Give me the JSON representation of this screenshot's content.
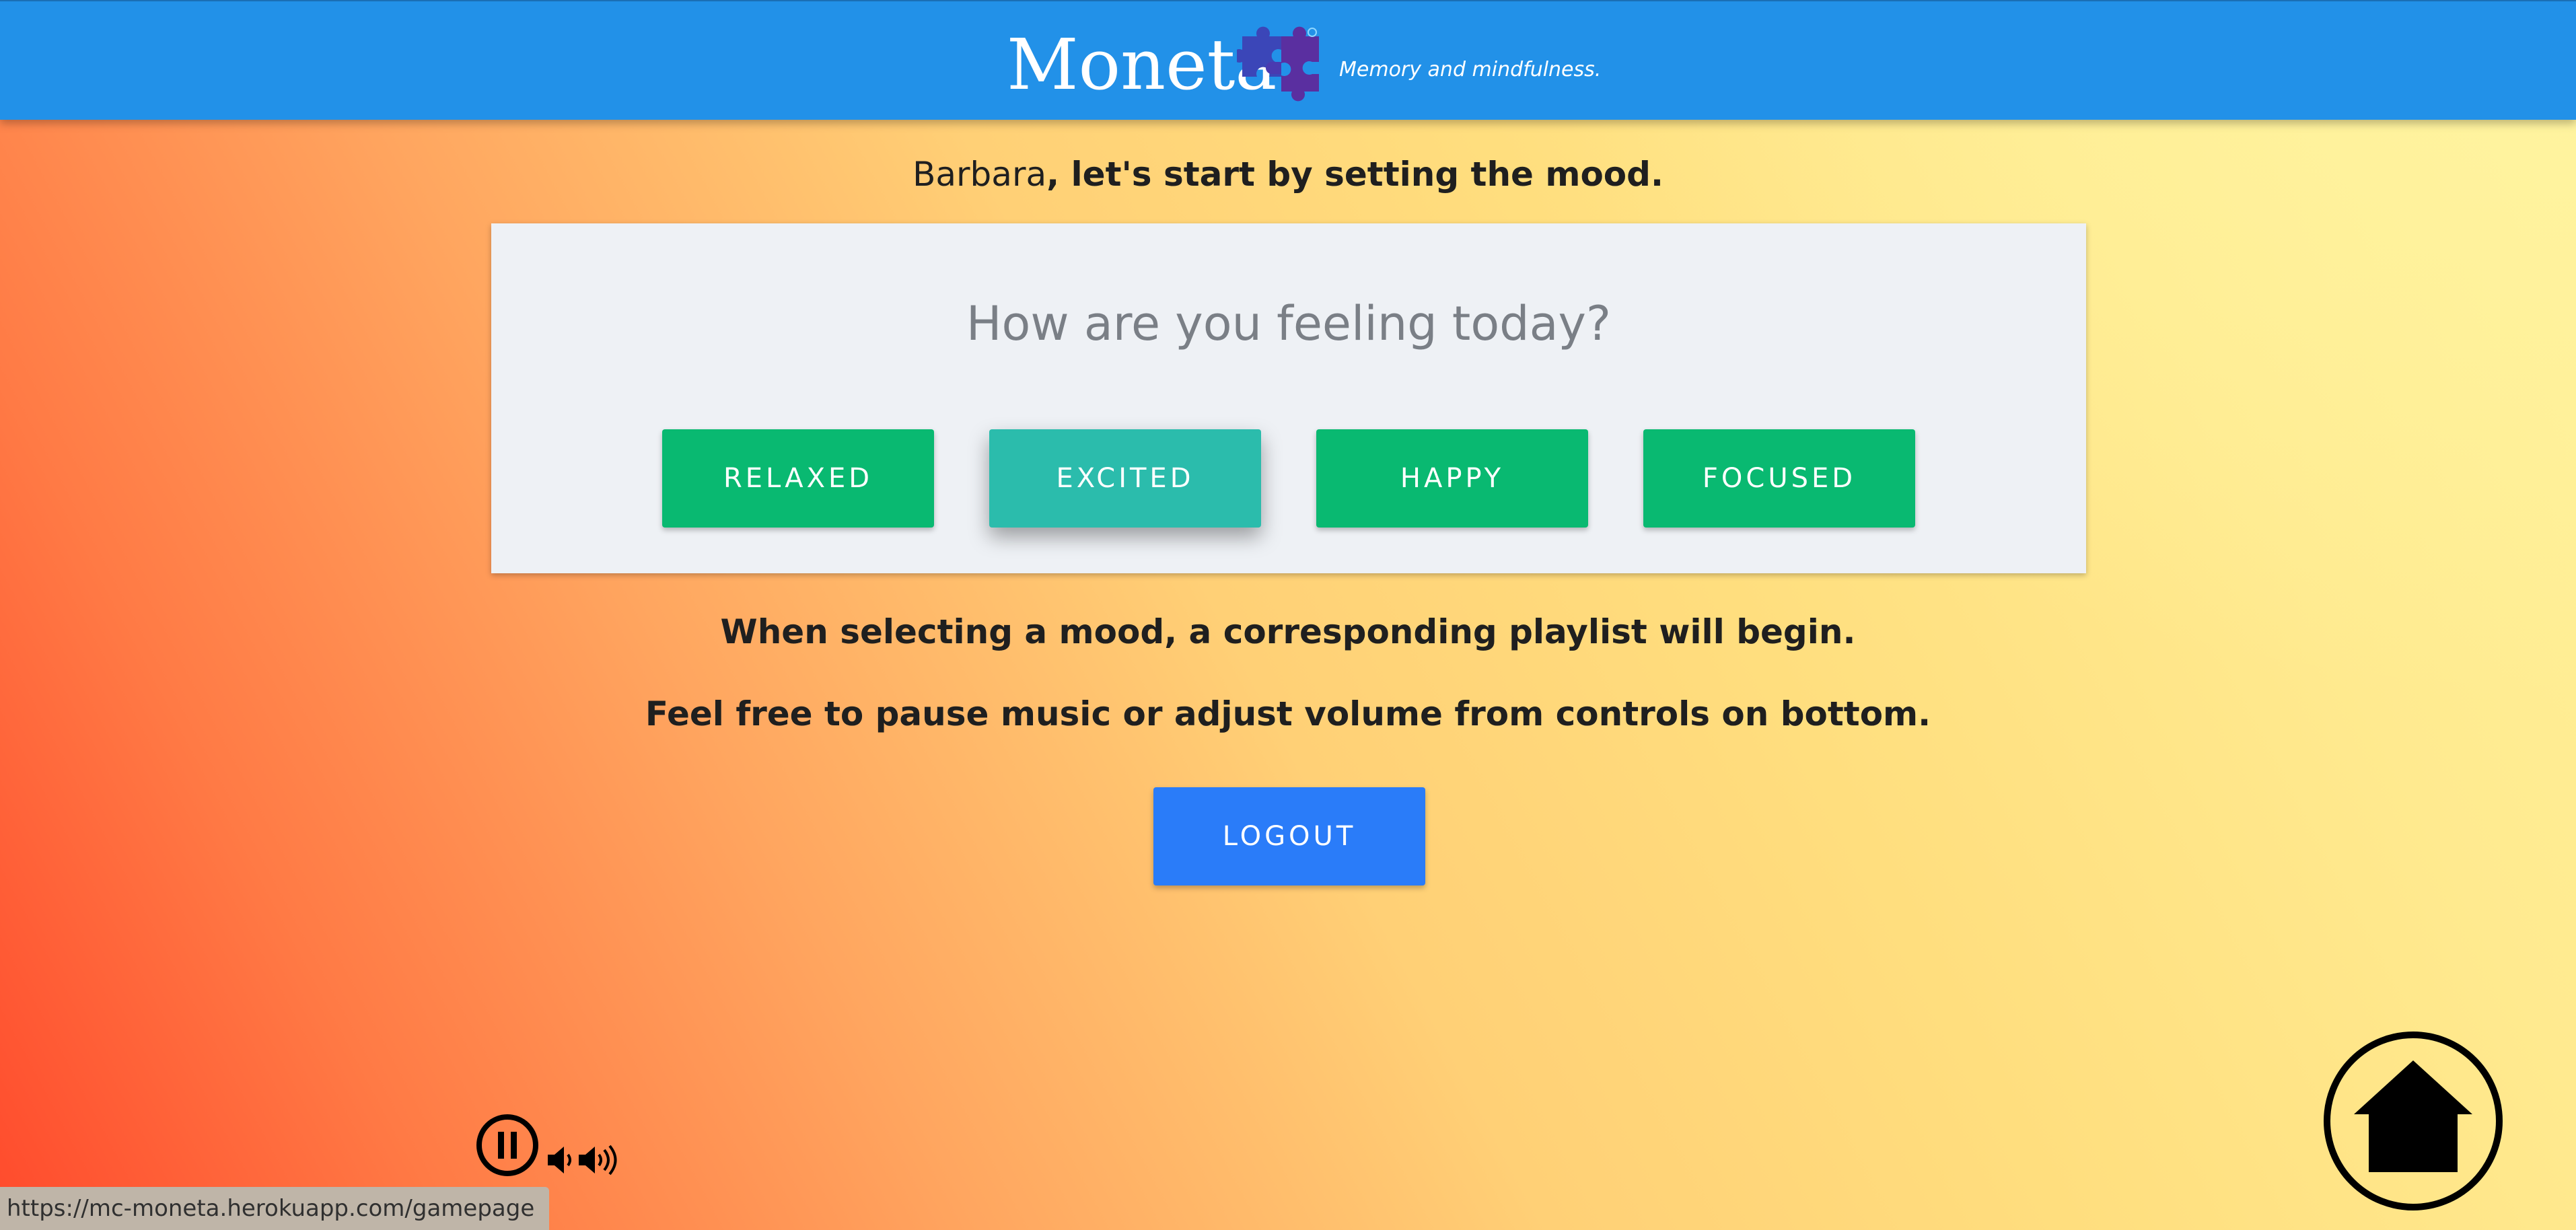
{
  "header": {
    "brand": "Moneta",
    "tagline": "Memory and mindfulness."
  },
  "greeting": {
    "name": "Barbara",
    "rest": ", let's start by setting the mood."
  },
  "mood_card": {
    "question": "How are you feeling today?",
    "moods": [
      {
        "label": "RELAXED",
        "selected": false
      },
      {
        "label": "EXCITED",
        "selected": true
      },
      {
        "label": "HAPPY",
        "selected": false
      },
      {
        "label": "FOCUSED",
        "selected": false
      }
    ]
  },
  "info": {
    "line1": "When selecting a mood, a corresponding playlist will begin.",
    "line2": "Feel free to pause music or adjust volume from controls on bottom."
  },
  "logout_label": "LOGOUT",
  "controls": {
    "pause_icon": "pause-circle-icon",
    "volume_down_icon": "volume-down-icon",
    "volume_up_icon": "volume-up-icon",
    "home_icon": "home-icon"
  },
  "status_bar": {
    "url": "https://mc-moneta.herokuapp.com/gamepage"
  },
  "colors": {
    "header": "#2291e8",
    "mood_button": "#09b971",
    "mood_button_selected": "#2bbcac",
    "logout_button": "#2a7cf9"
  }
}
